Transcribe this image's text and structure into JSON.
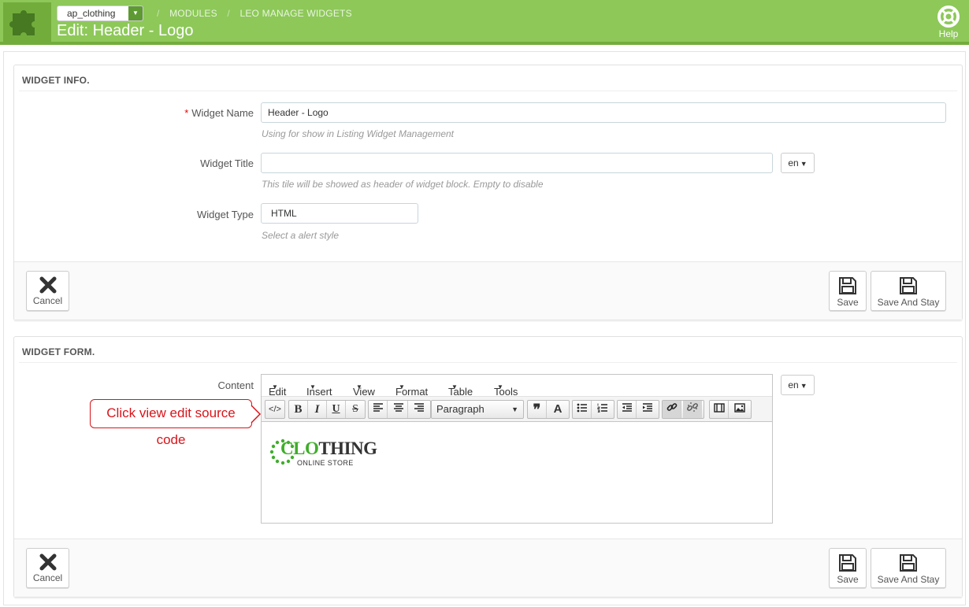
{
  "header": {
    "shop": "ap_clothing",
    "breadcrumbs": [
      "MODULES",
      "LEO MANAGE WIDGETS"
    ],
    "title": "Edit: Header - Logo",
    "help_label": "Help",
    "bg_color": "#8dc859"
  },
  "widget_info": {
    "heading": "WIDGET INFO.",
    "name_label": "Widget Name",
    "name_value": "Header - Logo",
    "name_hint": "Using for show in Listing Widget Management",
    "title_label": "Widget Title",
    "title_value": "",
    "title_hint": "This tile will be showed as header of widget block. Empty to disable",
    "title_lang": "en",
    "type_label": "Widget Type",
    "type_value": "HTML",
    "type_hint": "Select a alert style",
    "cancel_label": "Cancel",
    "save_label": "Save",
    "save_stay_label": "Save And Stay"
  },
  "widget_form": {
    "heading": "WIDGET FORM.",
    "content_label": "Content",
    "content_lang": "en",
    "menus": [
      "Edit",
      "Insert",
      "View",
      "Format",
      "Table",
      "Tools"
    ],
    "block_format": "Paragraph",
    "logo_brand_a": "CLO",
    "logo_brand_b": "THING",
    "logo_tagline": "ONLINE STORE",
    "callout": "Click view edit source code",
    "cancel_label": "Cancel",
    "save_label": "Save",
    "save_stay_label": "Save And Stay"
  }
}
